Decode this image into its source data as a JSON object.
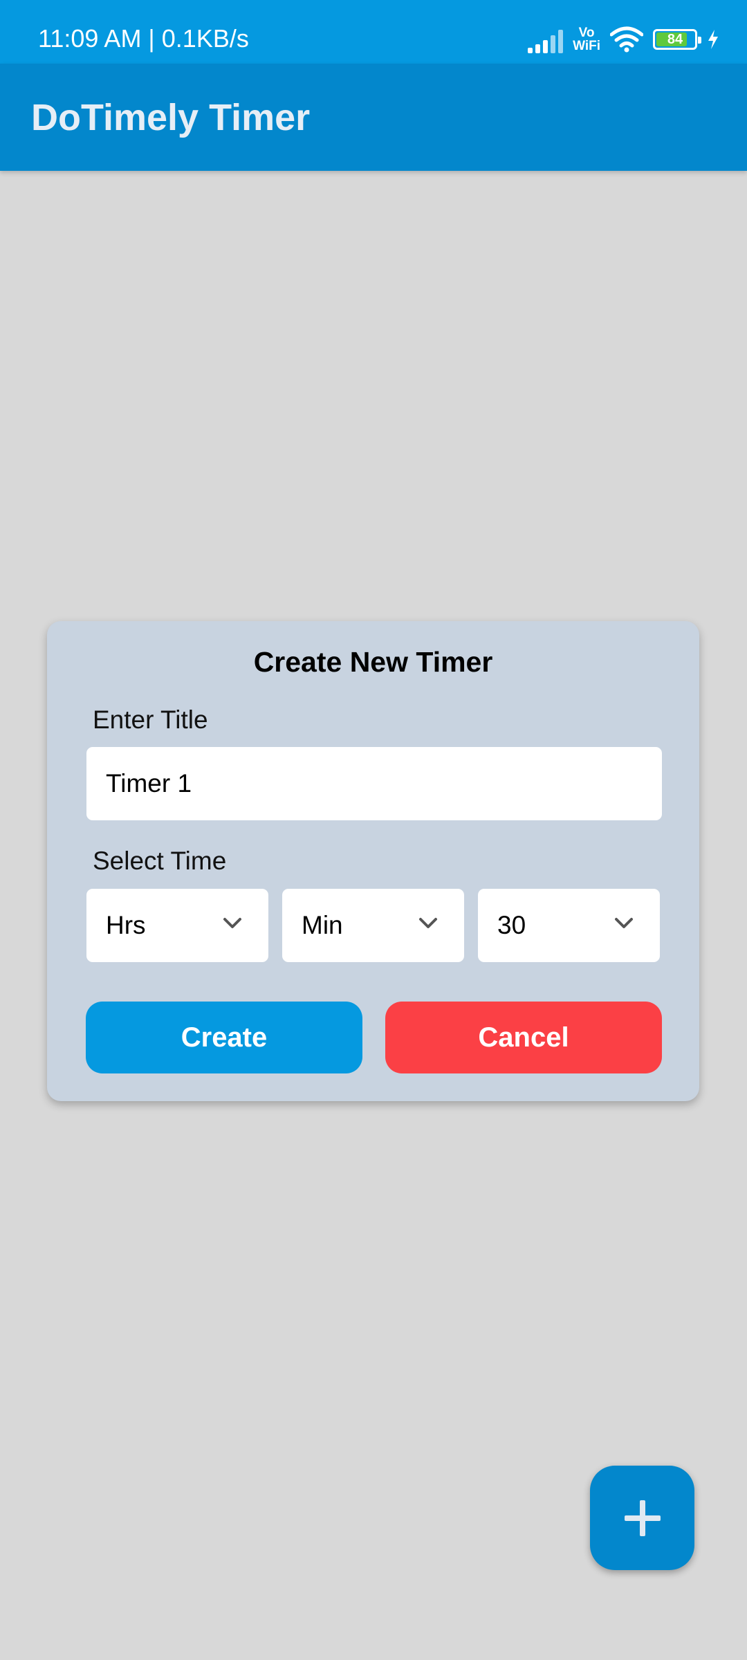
{
  "status_bar": {
    "time_speed": "11:09 AM | 0.1KB/s",
    "volte_line1": "Vo",
    "volte_line2": "WiFi",
    "battery_level": "84",
    "icons": [
      "signal-icon",
      "volte-wifi-icon",
      "wifi-icon",
      "battery-icon",
      "charging-bolt-icon"
    ]
  },
  "app_bar": {
    "title": "DoTimely Timer"
  },
  "dialog": {
    "title": "Create New Timer",
    "title_label": "Enter Title",
    "title_value": "Timer 1",
    "time_label": "Select Time",
    "hours_value": "Hrs",
    "minutes_value": "Min",
    "seconds_value": "30",
    "create_label": "Create",
    "cancel_label": "Cancel"
  },
  "fab": {
    "icon": "plus-icon"
  },
  "colors": {
    "status_bar": "#0599e0",
    "app_bar": "#0387cc",
    "background": "#d8d8d8",
    "dialog": "#c8d3e0",
    "create_button": "#0599e0",
    "cancel_button": "#fb4045",
    "fab": "#0387cc"
  }
}
